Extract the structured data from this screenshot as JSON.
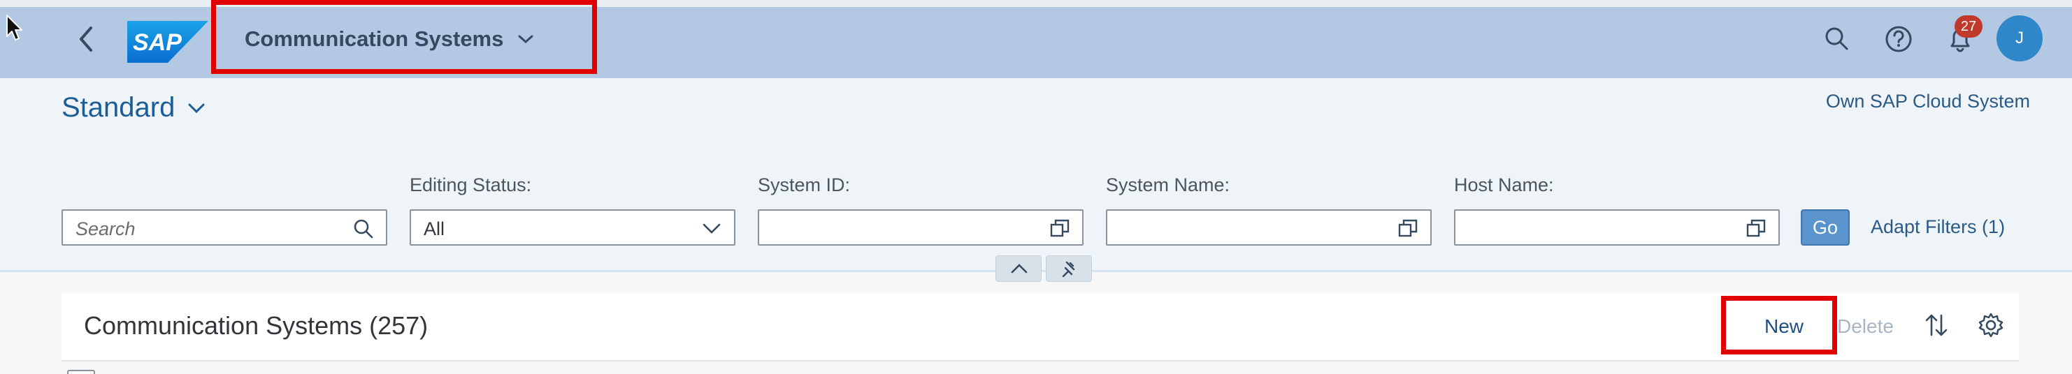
{
  "shell": {
    "app_title": "Communication Systems",
    "logo_text": "SAP",
    "notifications_count": "27",
    "avatar_initial": "J"
  },
  "header": {
    "variant": "Standard",
    "own_system_link": "Own SAP Cloud System"
  },
  "filters": {
    "search": {
      "placeholder": "Search",
      "value": ""
    },
    "editing_status": {
      "label": "Editing Status:",
      "value": "All"
    },
    "system_id": {
      "label": "System ID:",
      "value": ""
    },
    "system_name": {
      "label": "System Name:",
      "value": ""
    },
    "host_name": {
      "label": "Host Name:",
      "value": ""
    },
    "go_label": "Go",
    "adapt_label": "Adapt Filters (1)"
  },
  "table": {
    "title": "Communication Systems (257)",
    "new_label": "New",
    "delete_label": "Delete"
  },
  "colors": {
    "shell_bg": "#b3c8e3",
    "header_bg": "#eff4f9",
    "accent": "#1d5d96",
    "highlight": "#e00000",
    "badge": "#c0392b",
    "avatar": "#2f86c8"
  },
  "icons": [
    "back-icon",
    "sap-logo",
    "chevron-down-icon",
    "search-icon",
    "help-icon",
    "bell-icon",
    "value-help-icon",
    "collapse-icon",
    "pin-icon",
    "sort-icon",
    "settings-icon",
    "mouse-cursor"
  ]
}
